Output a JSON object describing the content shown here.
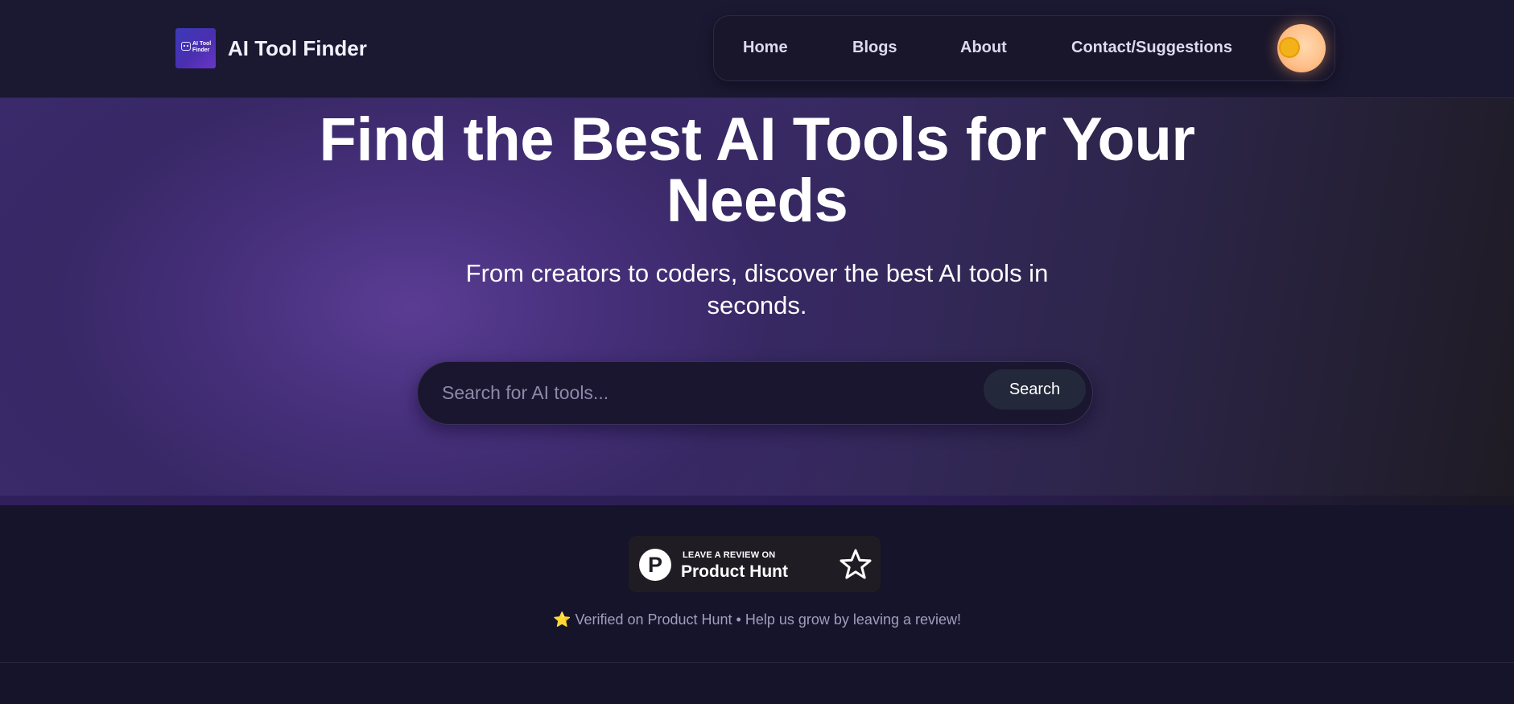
{
  "brand": {
    "name": "AI Tool Finder",
    "logo_text_line1": "AI Tool",
    "logo_text_line2": "Finder"
  },
  "nav": {
    "items": [
      {
        "label": "Home"
      },
      {
        "label": "Blogs"
      },
      {
        "label": "About"
      },
      {
        "label": "Contact/Suggestions"
      }
    ],
    "theme_toggle_icon": "sun-icon"
  },
  "hero": {
    "title_line1": "Find the Best AI Tools for Your",
    "title_line2": "Needs",
    "subtitle_line1": "From creators to coders, discover the best AI tools in",
    "subtitle_line2": "seconds."
  },
  "search": {
    "placeholder": "Search for AI tools...",
    "value": "",
    "button_label": "Search"
  },
  "product_hunt": {
    "small_text": "LEAVE A REVIEW ON",
    "big_text": "Product Hunt",
    "logo_letter": "P",
    "star_icon": "star-outline-icon"
  },
  "verified": {
    "emoji": "⭐",
    "text": "Verified on Product Hunt • Help us grow by leaving a review!"
  },
  "colors": {
    "header_bg": "#1b1832",
    "hero_accent": "#5c3e96",
    "page_bg": "#16142a",
    "toggle_glow": "#ffc08a"
  }
}
